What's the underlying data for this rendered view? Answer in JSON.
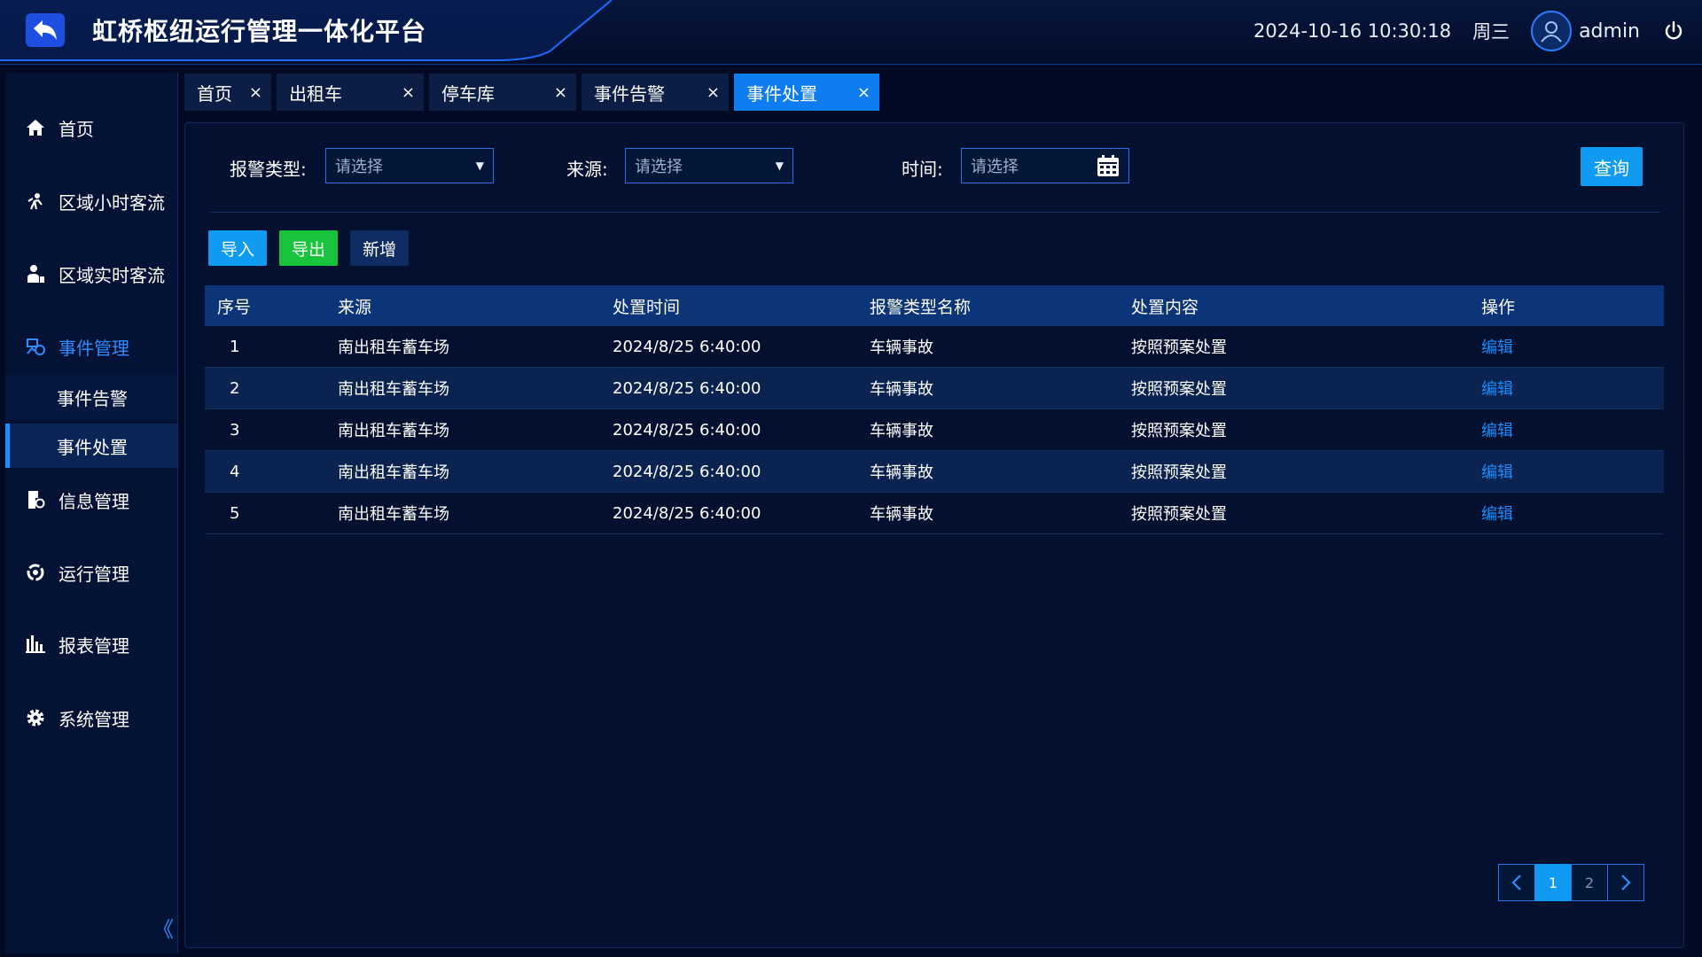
{
  "header": {
    "title": "虹桥枢纽运行管理一体化平台",
    "datetime": "2024-10-16 10:30:18",
    "weekday": "周三",
    "username": "admin"
  },
  "sidebar": {
    "items": [
      {
        "label": "首页",
        "icon": "home-icon"
      },
      {
        "label": "区域小时客流",
        "icon": "people-flow-icon"
      },
      {
        "label": "区域实时客流",
        "icon": "person-realtime-icon"
      },
      {
        "label": "事件管理",
        "icon": "event-icon"
      },
      {
        "label": "信息管理",
        "icon": "document-icon"
      },
      {
        "label": "运行管理",
        "icon": "operation-icon"
      },
      {
        "label": "报表管理",
        "icon": "bar-chart-icon"
      },
      {
        "label": "系统管理",
        "icon": "gear-icon"
      }
    ],
    "sub_items": [
      "事件告警",
      "事件处置"
    ],
    "collapse_glyph": "《"
  },
  "tabs": [
    {
      "label": "首页"
    },
    {
      "label": "出租车"
    },
    {
      "label": "停车库"
    },
    {
      "label": "事件告警"
    },
    {
      "label": "事件处置"
    }
  ],
  "tab_close": "×",
  "filters": {
    "alarm_type_label": "报警类型:",
    "source_label": "来源:",
    "time_label": "时间:",
    "placeholder": "请选择",
    "query_label": "查询"
  },
  "actions": {
    "import_label": "导入",
    "export_label": "导出",
    "add_label": "新增"
  },
  "table": {
    "headers": [
      "序号",
      "来源",
      "处置时间",
      "报警类型名称",
      "处置内容",
      "操作"
    ],
    "rows": [
      [
        "1",
        "南出租车蓄车场",
        "2024/8/25  6:40:00",
        "车辆事故",
        "按照预案处置",
        "编辑"
      ],
      [
        "2",
        "南出租车蓄车场",
        "2024/8/25  6:40:00",
        "车辆事故",
        "按照预案处置",
        "编辑"
      ],
      [
        "3",
        "南出租车蓄车场",
        "2024/8/25  6:40:00",
        "车辆事故",
        "按照预案处置",
        "编辑"
      ],
      [
        "4",
        "南出租车蓄车场",
        "2024/8/25  6:40:00",
        "车辆事故",
        "按照预案处置",
        "编辑"
      ],
      [
        "5",
        "南出租车蓄车场",
        "2024/8/25  6:40:00",
        "车辆事故",
        "按照预案处置",
        "编辑"
      ]
    ]
  },
  "pagination": {
    "pages": [
      "1",
      "2"
    ],
    "current": "1"
  },
  "colors": {
    "accent": "#0f9bf2",
    "export_green": "#18c43c",
    "background": "#020a24"
  }
}
